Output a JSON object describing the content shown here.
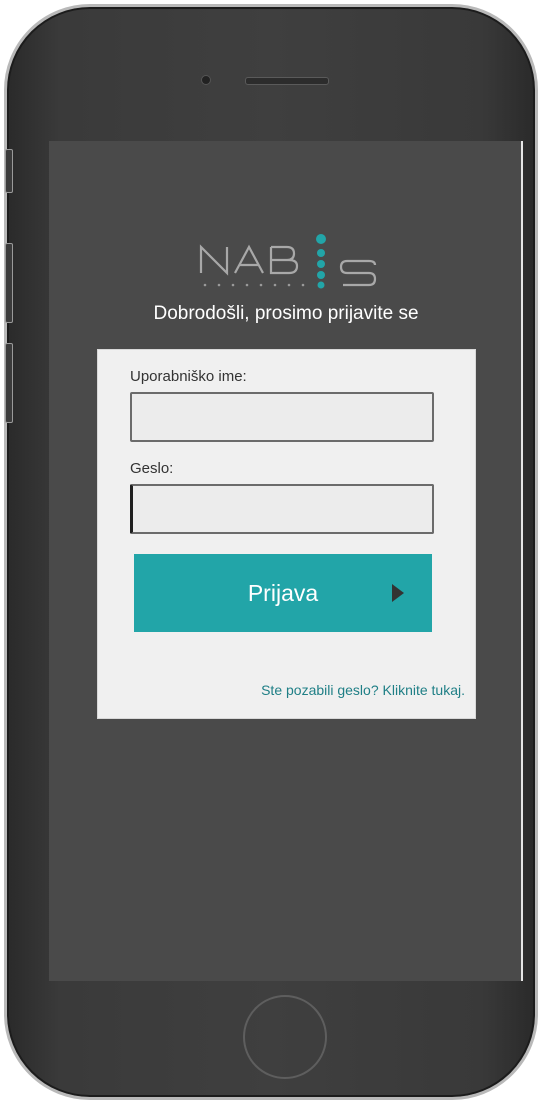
{
  "app": {
    "logo_text": "NABIS",
    "welcome": "Dobrodošli, prosimo prijavite se"
  },
  "login_form": {
    "username_label": "Uporabniško ime:",
    "username_value": "",
    "password_label": "Geslo:",
    "password_value": "",
    "submit_label": "Prijava",
    "forgot_link": "Ste pozabili geslo? Kliknite tukaj."
  },
  "colors": {
    "accent": "#22a5a8",
    "link": "#1f7f86",
    "screen_bg": "#4a4a4a",
    "card_bg": "#f0f0f0"
  },
  "icons": {
    "submit_icon": "play-arrow-icon"
  }
}
